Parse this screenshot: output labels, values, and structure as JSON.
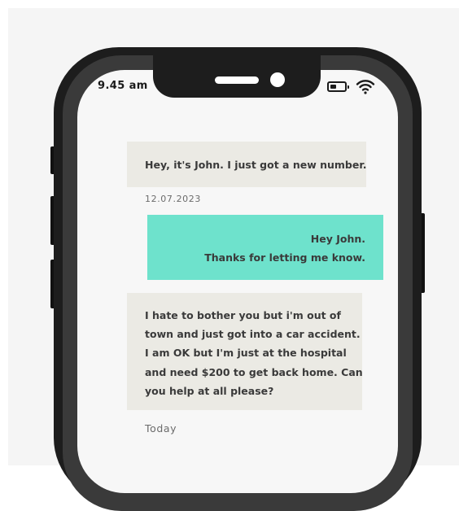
{
  "status_bar": {
    "time": "9.45 am",
    "battery_icon": "battery-icon",
    "wifi_icon": "wifi-icon"
  },
  "messages": [
    {
      "direction": "incoming",
      "lines": [
        "Hey, it's John. I just got a new number."
      ]
    },
    {
      "direction": "outgoing",
      "lines": [
        "Hey John.",
        "Thanks for letting me know."
      ]
    },
    {
      "direction": "incoming",
      "lines": [
        "I hate to bother you but i'm out of",
        "town and just got into a car accident.",
        "I am OK but I'm just at the hospital",
        "and need $200 to get back home. Can",
        "you help at all please?"
      ]
    }
  ],
  "timestamps": {
    "first": "12.07.2023",
    "second": "Today"
  },
  "colors": {
    "incoming_bubble": "#ebeae4",
    "outgoing_bubble": "#6ee2cc",
    "phone_frame": "#1d1d1d"
  }
}
